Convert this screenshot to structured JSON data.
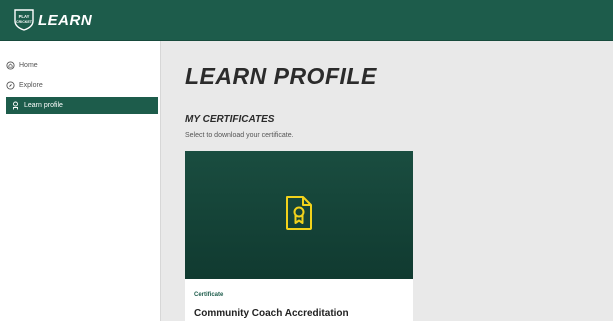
{
  "header": {
    "logo_small": "PLAY CRICKET",
    "logo_text": "LEARN"
  },
  "sidebar": {
    "items": [
      {
        "label": "Home",
        "icon": "home-icon"
      },
      {
        "label": "Explore",
        "icon": "compass-icon"
      },
      {
        "label": "Learn profile",
        "icon": "profile-icon",
        "active": true
      }
    ]
  },
  "main": {
    "title": "LEARN PROFILE",
    "section_title": "MY CERTIFICATES",
    "section_subtitle": "Select to download your certificate.",
    "card": {
      "kind": "Certificate",
      "name": "Community Coach Accreditation",
      "icon": "certificate-icon"
    }
  },
  "colors": {
    "brand": "#1d5c4b",
    "accent": "#f2d21b"
  }
}
